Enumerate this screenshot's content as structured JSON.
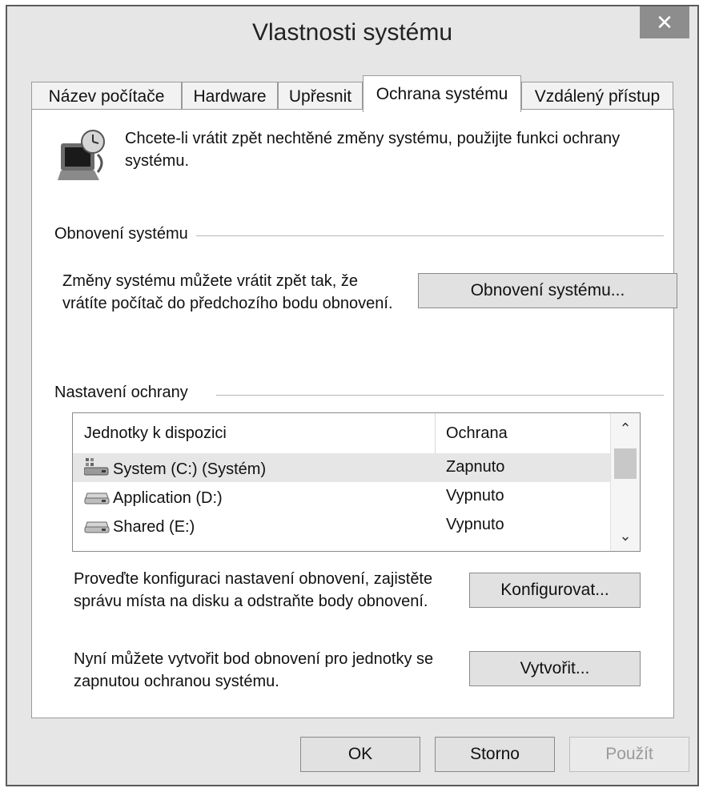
{
  "window": {
    "title": "Vlastnosti systému",
    "close_glyph": "✕"
  },
  "tabs": [
    {
      "label": "Název počítače",
      "active": false
    },
    {
      "label": "Hardware",
      "active": false
    },
    {
      "label": "Upřesnit",
      "active": false
    },
    {
      "label": "Ochrana systému",
      "active": true
    },
    {
      "label": "Vzdálený přístup",
      "active": false
    }
  ],
  "intro": {
    "icon": "system-protection-icon",
    "text": "Chcete-li vrátit zpět nechtěné změny systému, použijte funkci ochrany systému."
  },
  "restore_group": {
    "label": "Obnovení systému",
    "description": "Změny systému můžete vrátit zpět tak, že vrátíte počítač do předchozího bodu obnovení.",
    "button_label": "Obnovení systému..."
  },
  "protection_group": {
    "label": "Nastavení ochrany",
    "table": {
      "columns": [
        "Jednotky k dispozici",
        "Ochrana"
      ],
      "rows": [
        {
          "name": "System (C:) (Systém)",
          "protection": "Zapnuto",
          "icon": "system-drive-icon",
          "selected": true
        },
        {
          "name": "Application (D:)",
          "protection": "Vypnuto",
          "icon": "drive-icon",
          "selected": false
        },
        {
          "name": "Shared (E:)",
          "protection": "Vypnuto",
          "icon": "drive-icon",
          "selected": false
        }
      ],
      "scroll_up_glyph": "⌃",
      "scroll_down_glyph": "⌄"
    },
    "configure_text": "Proveďte konfiguraci nastavení obnovení, zajistěte správu místa na disku a odstraňte body obnovení.",
    "configure_button": "Konfigurovat...",
    "create_text": "Nyní můžete vytvořit bod obnovení pro jednotky se zapnutou ochranou systému.",
    "create_button": "Vytvořit..."
  },
  "footer": {
    "ok": "OK",
    "cancel": "Storno",
    "apply": "Použít",
    "apply_enabled": false
  }
}
